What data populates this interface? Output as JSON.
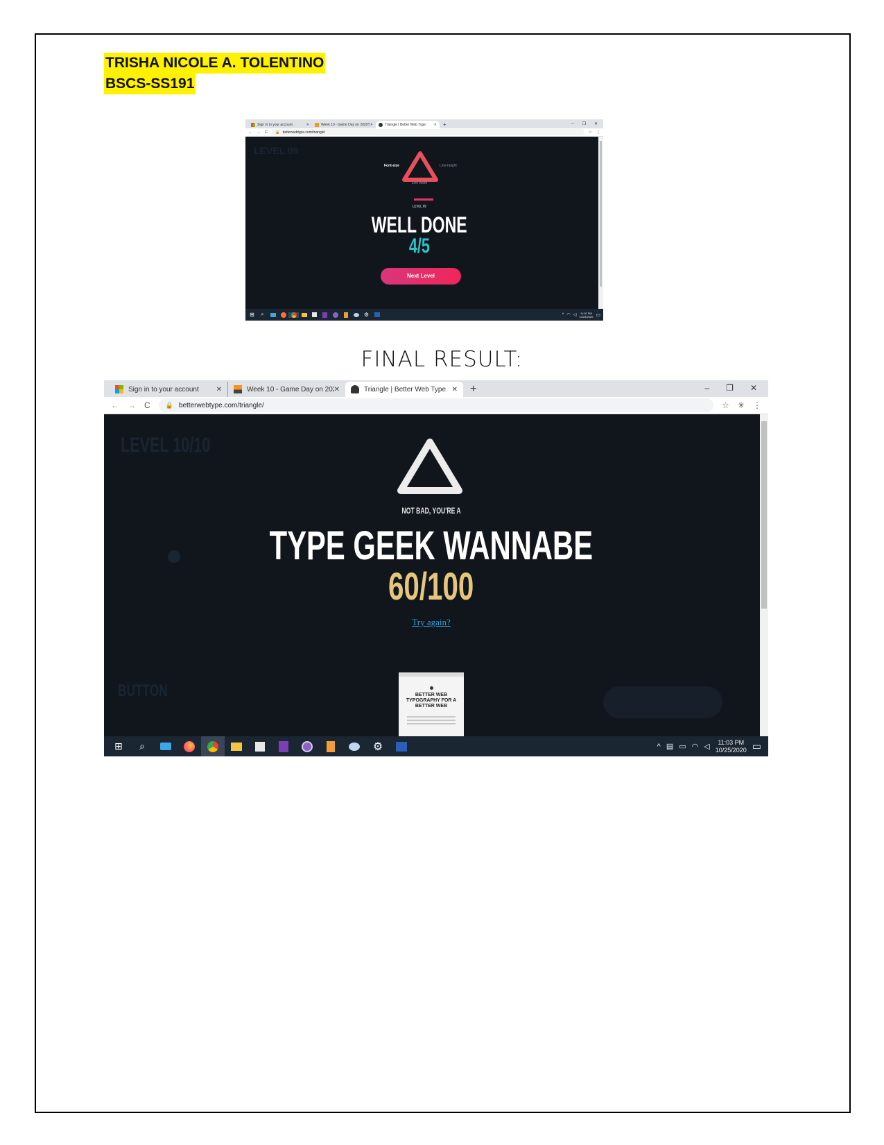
{
  "author": {
    "name": "TRISHA NICOLE A. TOLENTINO",
    "section": "BSCS-SS191"
  },
  "final_label": "FINAL RESULT:",
  "browser": {
    "tabs": [
      {
        "label": "Sign in to your account",
        "icon": "microsoft-logo-icon",
        "active": false
      },
      {
        "label": "Week 10 - Game Day on 2020T1",
        "icon": "moodle-icon",
        "active": false
      },
      {
        "label": "Triangle | Better Web Type",
        "icon": "hand-icon",
        "active": true
      }
    ],
    "new_tab": "+",
    "url": "betterwebtype.com/triangle/",
    "window_controls": [
      "–",
      "❐",
      "✕"
    ]
  },
  "shot1": {
    "labels": {
      "font_size": "Font-size",
      "line_height": "Line-height",
      "line_width": "Line width"
    },
    "level": "LEVEL 09",
    "headline": "WELL DONE",
    "score": "4/5",
    "button": "Next Level",
    "clock": {
      "time": "11:02 PM",
      "date": "10/25/2020"
    },
    "colors": {
      "triangle": "#e8505b",
      "score": "#2bc1c8",
      "button": "#e8316f"
    }
  },
  "shot2": {
    "ghost_level": "LEVEL 10/10",
    "ghost_bottom": "BUTTON",
    "subline": "NOT BAD, YOU'RE A",
    "headline": "TYPE GEEK WANNABE",
    "score": "60/100",
    "link": "Try again?",
    "book_title": "BETTER WEB TYPOGRAPHY FOR A BETTER WEB",
    "clock": {
      "time": "11:03 PM",
      "date": "10/25/2020"
    },
    "colors": {
      "triangle": "#ececec",
      "score": "#e6c67c",
      "link": "#3a9bd6"
    }
  },
  "taskbar_icons": [
    "windows-start-icon",
    "search-icon",
    "mail-icon",
    "firefox-icon",
    "chrome-icon",
    "file-explorer-icon",
    "store-icon",
    "onenote-icon",
    "app-icon",
    "sublime-icon",
    "paint-icon",
    "settings-icon",
    "word-icon"
  ]
}
